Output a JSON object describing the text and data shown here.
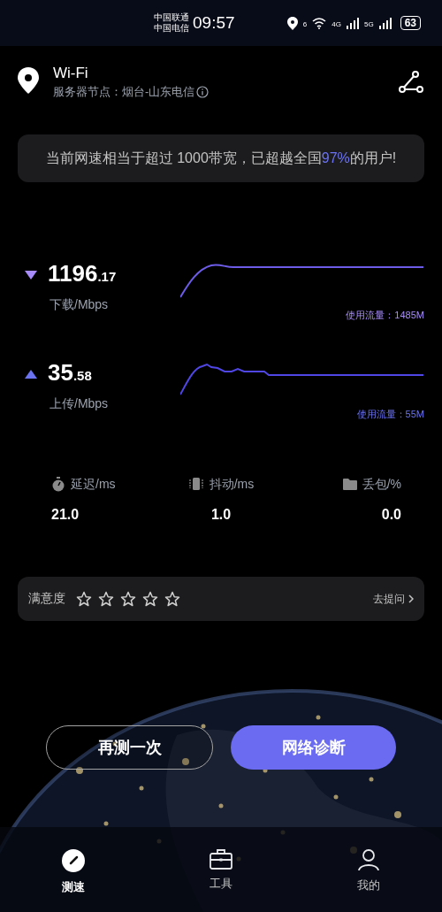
{
  "status_bar": {
    "carrier_1": "中国联通",
    "carrier_2": "中国电信",
    "time": "09:57",
    "wifi_badge": "6",
    "net_1": "4G",
    "net_2": "5G",
    "battery": "63"
  },
  "header": {
    "title": "Wi-Fi",
    "server_label": "服务器节点：",
    "server": "烟台-山东电信"
  },
  "banner": {
    "before": "当前网速相当于超过 1000带宽，已超越全国",
    "highlight": "97%",
    "after": "的用户!"
  },
  "speeds": [
    {
      "kind": "download",
      "integer": "1196",
      "decimal": ".17",
      "unit": "下载/Mbps",
      "usage": "使用流量：1485M",
      "color": "#a78bfa"
    },
    {
      "kind": "upload",
      "integer": "35",
      "decimal": ".58",
      "unit": "上传/Mbps",
      "usage": "使用流量：55M",
      "color": "#6b73f0"
    }
  ],
  "metrics": [
    {
      "kind": "latency",
      "label": "延迟/ms",
      "value": "21.0"
    },
    {
      "kind": "jitter",
      "label": "抖动/ms",
      "value": "1.0"
    },
    {
      "kind": "loss",
      "label": "丢包/%",
      "value": "0.0"
    }
  ],
  "rating": {
    "label": "满意度",
    "stars": 0,
    "link": "去提问"
  },
  "buttons": [
    {
      "kind": "outline",
      "label": "再测一次"
    },
    {
      "kind": "primary",
      "label": "网络诊断"
    }
  ],
  "tabs": [
    {
      "kind": "speed",
      "label": "测速",
      "selected": true
    },
    {
      "kind": "tools",
      "label": "工具",
      "selected": false
    },
    {
      "kind": "me",
      "label": "我的",
      "selected": false
    }
  ]
}
